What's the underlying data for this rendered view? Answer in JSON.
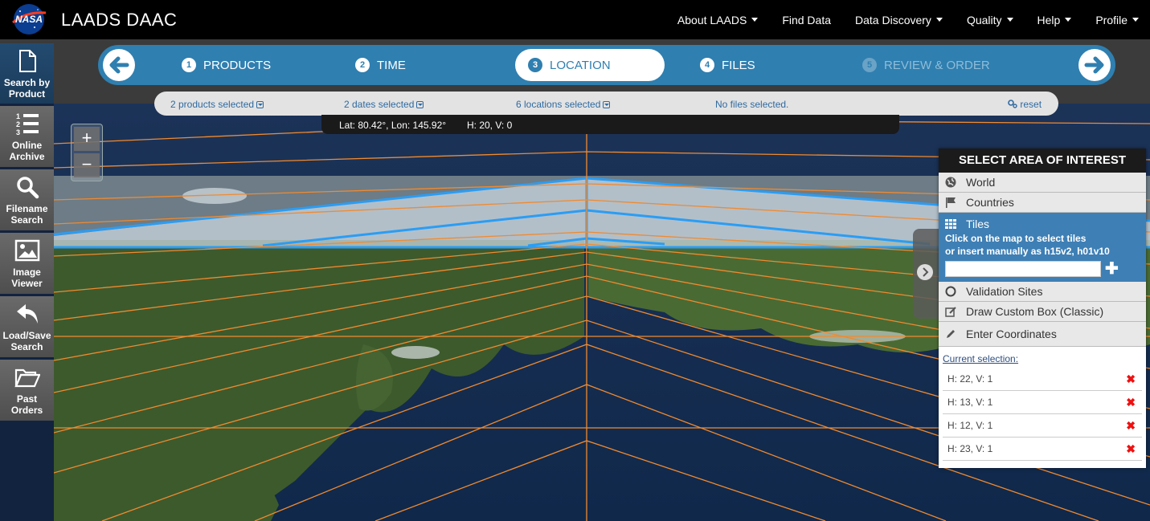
{
  "header": {
    "brand": "LAADS DAAC",
    "logo_icon": "nasa-meatball-logo",
    "nav": [
      {
        "label": "About LAADS",
        "dropdown": true
      },
      {
        "label": "Find Data",
        "dropdown": false
      },
      {
        "label": "Data Discovery",
        "dropdown": true
      },
      {
        "label": "Quality",
        "dropdown": true
      },
      {
        "label": "Help",
        "dropdown": true
      },
      {
        "label": "Profile",
        "dropdown": true
      }
    ]
  },
  "sidebar": {
    "items": [
      {
        "label": "Search by Product",
        "icon": "document-icon"
      },
      {
        "label": "Online Archive",
        "icon": "numbered-list-icon"
      },
      {
        "label": "Filename Search",
        "icon": "search-icon"
      },
      {
        "label": "Image Viewer",
        "icon": "image-icon"
      },
      {
        "label": "Load/Save Search",
        "icon": "reply-arrow-icon"
      },
      {
        "label": "Past Orders",
        "icon": "folder-open-icon"
      }
    ]
  },
  "wizard": {
    "steps": [
      {
        "num": "1",
        "label": "PRODUCTS",
        "state": "done"
      },
      {
        "num": "2",
        "label": "TIME",
        "state": "done"
      },
      {
        "num": "3",
        "label": "LOCATION",
        "state": "active"
      },
      {
        "num": "4",
        "label": "FILES",
        "state": "done"
      },
      {
        "num": "5",
        "label": "REVIEW & ORDER",
        "state": "disabled"
      }
    ]
  },
  "summary": {
    "products": "2 products selected",
    "dates": "2 dates selected",
    "locations": "6 locations selected",
    "files": "No files selected.",
    "reset": "reset"
  },
  "map": {
    "lat_lon": "Lat: 80.42°, Lon: 145.92°",
    "tile": "H: 20, V: 0",
    "zoom_in": "+",
    "zoom_out": "−"
  },
  "panel": {
    "title": "SELECT AREA OF INTEREST",
    "options": {
      "world": "World",
      "countries": "Countries",
      "tiles": "Tiles",
      "tiles_hint_1": "Click on the map to select tiles",
      "tiles_hint_2": "or insert manually as h15v2, h01v10",
      "validation": "Validation Sites",
      "custom_box": "Draw Custom Box (Classic)",
      "coordinates": "Enter Coordinates"
    },
    "tile_input_value": "",
    "current_selection_label": "Current selection:",
    "selection": [
      "H: 22, V: 1",
      "H: 13, V: 1",
      "H: 12, V: 1",
      "H: 23, V: 1"
    ]
  },
  "colors": {
    "accent": "#2f7fb0",
    "grid_line": "#f08a30",
    "selection_outline": "#2a9df4"
  }
}
